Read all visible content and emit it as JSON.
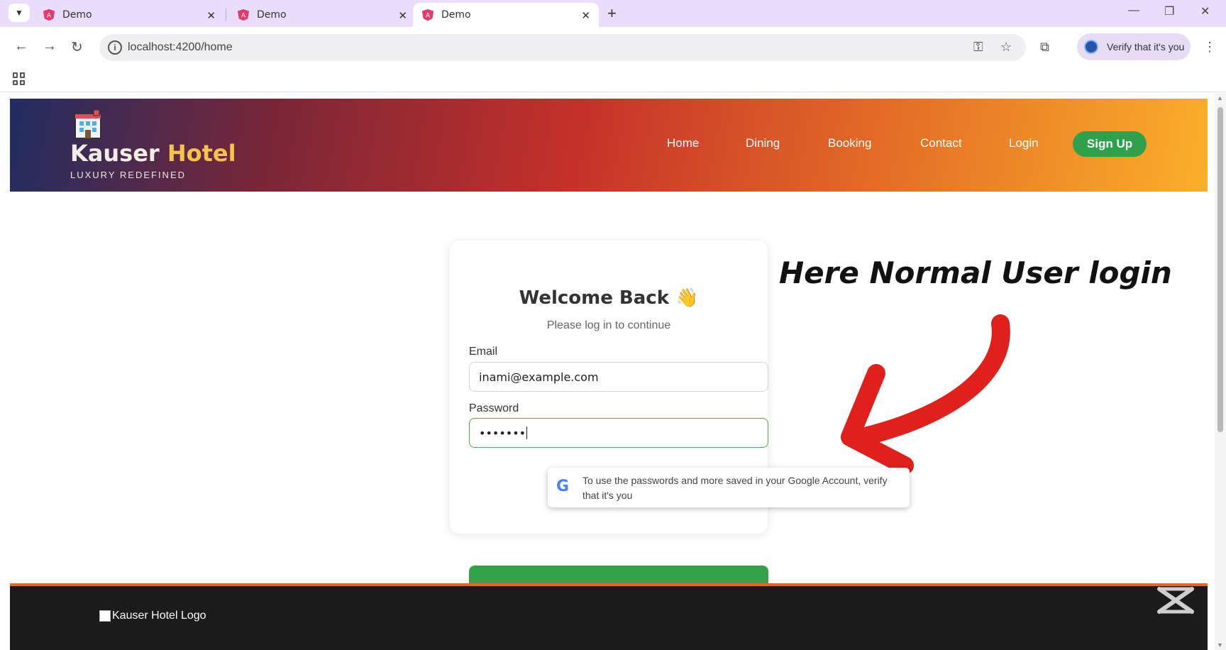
{
  "browser": {
    "tabs": [
      {
        "title": "Demo",
        "active": false
      },
      {
        "title": "Demo",
        "active": false
      },
      {
        "title": "Demo",
        "active": true
      }
    ],
    "url": "localhost:4200/home",
    "profile_label": "Verify that it's you"
  },
  "header": {
    "brand_part1": "Kauser",
    "brand_part2": "Hotel",
    "tagline": "LUXURY REDEFINED",
    "nav": [
      "Home",
      "Dining",
      "Booking",
      "Contact",
      "Login"
    ],
    "signup_label": "Sign Up"
  },
  "login": {
    "title": "Welcome Back 👋",
    "subtitle": "Please log in to continue",
    "email_label": "Email",
    "email_value": "inami@example.com",
    "password_label": "Password",
    "password_value": "•••••••"
  },
  "google_popup": {
    "text": "To use the passwords and more saved in your Google Account, verify that it's you"
  },
  "annotation": "Here Normal User login",
  "footer": {
    "logo_alt": "Kauser Hotel Logo"
  },
  "colors": {
    "accent_green": "#34a04a",
    "annotation_arrow": "#e0201c",
    "header_gradient_start": "#212d62",
    "header_gradient_end": "#fbaf2a"
  }
}
